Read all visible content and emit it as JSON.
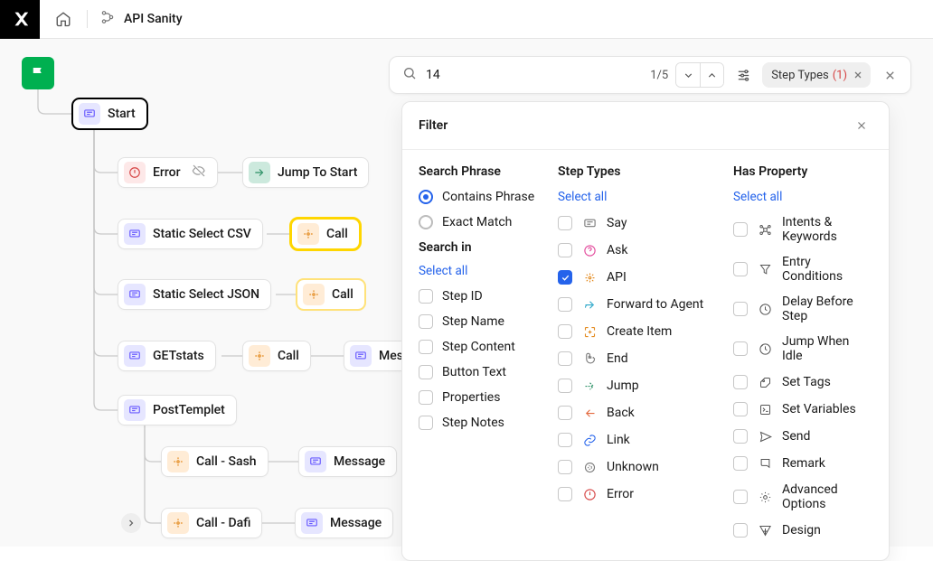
{
  "header": {
    "breadcrumb_title": "API Sanity"
  },
  "flow": {
    "start": "Start",
    "error": "Error",
    "jump": "Jump To Start",
    "static_csv": "Static Select CSV",
    "call_csv": "Call",
    "static_json": "Static Select JSON",
    "call_json": "Call",
    "getstats": "GETstats",
    "call_get": "Call",
    "mes_get": "Mes",
    "posttemplet": "PostTemplet",
    "call_sash": "Call - Sash",
    "msg_sash": "Message",
    "call_dafi": "Call - Dafi",
    "msg_dafi": "Message"
  },
  "search": {
    "query": "14",
    "counter": "1/5",
    "chip_label": "Step Types",
    "chip_count": "(1)"
  },
  "filter": {
    "title": "Filter",
    "col1": {
      "heading": "Search Phrase",
      "contains": "Contains Phrase",
      "exact": "Exact Match",
      "searchin": "Search in",
      "select_all": "Select all",
      "items": [
        "Step ID",
        "Step Name",
        "Step Content",
        "Button Text",
        "Properties",
        "Step Notes"
      ]
    },
    "col2": {
      "heading": "Step Types",
      "select_all": "Select all",
      "items": [
        {
          "label": "Say",
          "color": "#7a7a7a"
        },
        {
          "label": "Ask",
          "color": "#e34a9c"
        },
        {
          "label": "API",
          "color": "#e38a1f",
          "on": true
        },
        {
          "label": "Forward to Agent",
          "color": "#2aa6c9"
        },
        {
          "label": "Create Item",
          "color": "#e38a1f"
        },
        {
          "label": "End",
          "color": "#7a7a7a"
        },
        {
          "label": "Jump",
          "color": "#2a8f64"
        },
        {
          "label": "Back",
          "color": "#e36a3f"
        },
        {
          "label": "Link",
          "color": "#2563eb"
        },
        {
          "label": "Unknown",
          "color": "#7a7a7a"
        },
        {
          "label": "Error",
          "color": "#d64545"
        }
      ]
    },
    "col3": {
      "heading": "Has Property",
      "select_all": "Select all",
      "items": [
        "Intents & Keywords",
        "Entry Conditions",
        "Delay Before Step",
        "Jump When Idle",
        "Set Tags",
        "Set Variables",
        "Send",
        "Remark",
        "Advanced Options",
        "Design"
      ]
    }
  }
}
